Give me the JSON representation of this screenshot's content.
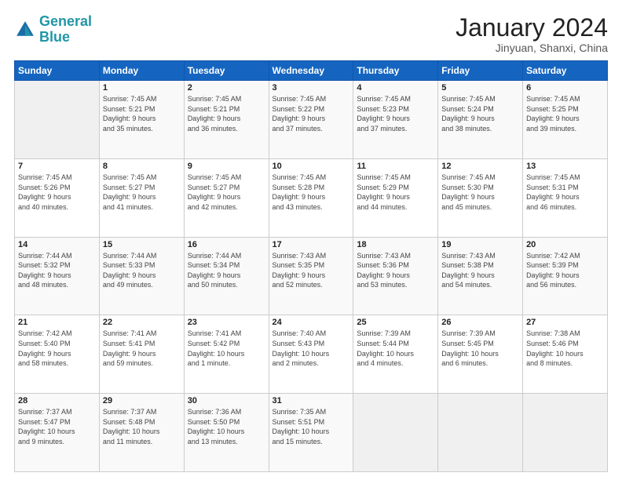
{
  "header": {
    "logo_general": "General",
    "logo_blue": "Blue",
    "month_title": "January 2024",
    "location": "Jinyuan, Shanxi, China"
  },
  "weekdays": [
    "Sunday",
    "Monday",
    "Tuesday",
    "Wednesday",
    "Thursday",
    "Friday",
    "Saturday"
  ],
  "weeks": [
    [
      {
        "day": "",
        "info": ""
      },
      {
        "day": "1",
        "info": "Sunrise: 7:45 AM\nSunset: 5:21 PM\nDaylight: 9 hours\nand 35 minutes."
      },
      {
        "day": "2",
        "info": "Sunrise: 7:45 AM\nSunset: 5:21 PM\nDaylight: 9 hours\nand 36 minutes."
      },
      {
        "day": "3",
        "info": "Sunrise: 7:45 AM\nSunset: 5:22 PM\nDaylight: 9 hours\nand 37 minutes."
      },
      {
        "day": "4",
        "info": "Sunrise: 7:45 AM\nSunset: 5:23 PM\nDaylight: 9 hours\nand 37 minutes."
      },
      {
        "day": "5",
        "info": "Sunrise: 7:45 AM\nSunset: 5:24 PM\nDaylight: 9 hours\nand 38 minutes."
      },
      {
        "day": "6",
        "info": "Sunrise: 7:45 AM\nSunset: 5:25 PM\nDaylight: 9 hours\nand 39 minutes."
      }
    ],
    [
      {
        "day": "7",
        "info": "Sunrise: 7:45 AM\nSunset: 5:26 PM\nDaylight: 9 hours\nand 40 minutes."
      },
      {
        "day": "8",
        "info": "Sunrise: 7:45 AM\nSunset: 5:27 PM\nDaylight: 9 hours\nand 41 minutes."
      },
      {
        "day": "9",
        "info": "Sunrise: 7:45 AM\nSunset: 5:27 PM\nDaylight: 9 hours\nand 42 minutes."
      },
      {
        "day": "10",
        "info": "Sunrise: 7:45 AM\nSunset: 5:28 PM\nDaylight: 9 hours\nand 43 minutes."
      },
      {
        "day": "11",
        "info": "Sunrise: 7:45 AM\nSunset: 5:29 PM\nDaylight: 9 hours\nand 44 minutes."
      },
      {
        "day": "12",
        "info": "Sunrise: 7:45 AM\nSunset: 5:30 PM\nDaylight: 9 hours\nand 45 minutes."
      },
      {
        "day": "13",
        "info": "Sunrise: 7:45 AM\nSunset: 5:31 PM\nDaylight: 9 hours\nand 46 minutes."
      }
    ],
    [
      {
        "day": "14",
        "info": "Sunrise: 7:44 AM\nSunset: 5:32 PM\nDaylight: 9 hours\nand 48 minutes."
      },
      {
        "day": "15",
        "info": "Sunrise: 7:44 AM\nSunset: 5:33 PM\nDaylight: 9 hours\nand 49 minutes."
      },
      {
        "day": "16",
        "info": "Sunrise: 7:44 AM\nSunset: 5:34 PM\nDaylight: 9 hours\nand 50 minutes."
      },
      {
        "day": "17",
        "info": "Sunrise: 7:43 AM\nSunset: 5:35 PM\nDaylight: 9 hours\nand 52 minutes."
      },
      {
        "day": "18",
        "info": "Sunrise: 7:43 AM\nSunset: 5:36 PM\nDaylight: 9 hours\nand 53 minutes."
      },
      {
        "day": "19",
        "info": "Sunrise: 7:43 AM\nSunset: 5:38 PM\nDaylight: 9 hours\nand 54 minutes."
      },
      {
        "day": "20",
        "info": "Sunrise: 7:42 AM\nSunset: 5:39 PM\nDaylight: 9 hours\nand 56 minutes."
      }
    ],
    [
      {
        "day": "21",
        "info": "Sunrise: 7:42 AM\nSunset: 5:40 PM\nDaylight: 9 hours\nand 58 minutes."
      },
      {
        "day": "22",
        "info": "Sunrise: 7:41 AM\nSunset: 5:41 PM\nDaylight: 9 hours\nand 59 minutes."
      },
      {
        "day": "23",
        "info": "Sunrise: 7:41 AM\nSunset: 5:42 PM\nDaylight: 10 hours\nand 1 minute."
      },
      {
        "day": "24",
        "info": "Sunrise: 7:40 AM\nSunset: 5:43 PM\nDaylight: 10 hours\nand 2 minutes."
      },
      {
        "day": "25",
        "info": "Sunrise: 7:39 AM\nSunset: 5:44 PM\nDaylight: 10 hours\nand 4 minutes."
      },
      {
        "day": "26",
        "info": "Sunrise: 7:39 AM\nSunset: 5:45 PM\nDaylight: 10 hours\nand 6 minutes."
      },
      {
        "day": "27",
        "info": "Sunrise: 7:38 AM\nSunset: 5:46 PM\nDaylight: 10 hours\nand 8 minutes."
      }
    ],
    [
      {
        "day": "28",
        "info": "Sunrise: 7:37 AM\nSunset: 5:47 PM\nDaylight: 10 hours\nand 9 minutes."
      },
      {
        "day": "29",
        "info": "Sunrise: 7:37 AM\nSunset: 5:48 PM\nDaylight: 10 hours\nand 11 minutes."
      },
      {
        "day": "30",
        "info": "Sunrise: 7:36 AM\nSunset: 5:50 PM\nDaylight: 10 hours\nand 13 minutes."
      },
      {
        "day": "31",
        "info": "Sunrise: 7:35 AM\nSunset: 5:51 PM\nDaylight: 10 hours\nand 15 minutes."
      },
      {
        "day": "",
        "info": ""
      },
      {
        "day": "",
        "info": ""
      },
      {
        "day": "",
        "info": ""
      }
    ]
  ]
}
